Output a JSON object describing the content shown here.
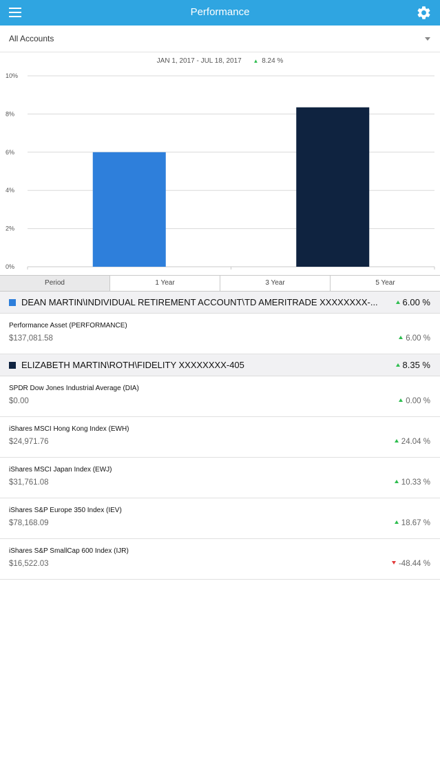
{
  "nav": {
    "title": "Performance",
    "menu_icon": "hamburger-menu-icon",
    "settings_icon": "gear-icon"
  },
  "account_selector": {
    "value": "All Accounts"
  },
  "chart_header": {
    "date_range": "JAN 1, 2017 - JUL 18, 2017",
    "change": "8.24 %"
  },
  "colors": {
    "nav": "#2fa5e1",
    "bar1": "#2e7fdb",
    "bar2": "#0f2340",
    "up": "#2ebd4f",
    "down": "#e23b3b"
  },
  "chart_data": {
    "type": "bar",
    "categories": [
      "DEAN MARTIN\\INDIVIDUAL RETIREMENT ACCOUNT\\TD AMERITRADE",
      "ELIZABETH MARTIN\\ROTH\\FIDELITY"
    ],
    "values": [
      6.0,
      8.35
    ],
    "colors": [
      "#2e7fdb",
      "#0f2340"
    ],
    "yticks": [
      "0%",
      "2%",
      "4%",
      "6%",
      "8%",
      "10%"
    ],
    "ylim": [
      0,
      10
    ],
    "grid": true,
    "title": "",
    "xlabel": "",
    "ylabel": ""
  },
  "periods": [
    "Period",
    "1 Year",
    "3 Year",
    "5 Year"
  ],
  "groups": [
    {
      "name": "DEAN MARTIN\\INDIVIDUAL RETIREMENT ACCOUNT\\TD AMERITRADE XXXXXXXX-...",
      "percent": "6.00 %",
      "color": "#2e7fdb",
      "holdings": [
        {
          "name": "Performance Asset (PERFORMANCE)",
          "value": "$137,081.58",
          "percent": "6.00 %",
          "direction": "up"
        }
      ]
    },
    {
      "name": "ELIZABETH MARTIN\\ROTH\\FIDELITY XXXXXXXX-405",
      "percent": "8.35 %",
      "color": "#0f2340",
      "holdings": [
        {
          "name": "SPDR Dow Jones Industrial Average (DIA)",
          "value": "$0.00",
          "percent": "0.00 %",
          "direction": "up"
        },
        {
          "name": "iShares MSCI Hong Kong Index (EWH)",
          "value": "$24,971.76",
          "percent": "24.04 %",
          "direction": "up"
        },
        {
          "name": "iShares MSCI Japan Index (EWJ)",
          "value": "$31,761.08",
          "percent": "10.33 %",
          "direction": "up"
        },
        {
          "name": "iShares S&P Europe 350 Index (IEV)",
          "value": "$78,168.09",
          "percent": "18.67 %",
          "direction": "up"
        },
        {
          "name": "iShares S&P SmallCap 600 Index (IJR)",
          "value": "$16,522.03",
          "percent": "-48.44 %",
          "direction": "down"
        }
      ]
    }
  ]
}
